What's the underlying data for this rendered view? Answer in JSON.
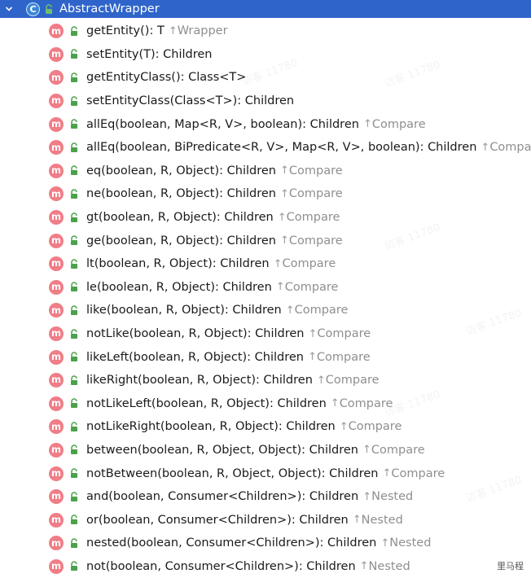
{
  "header": {
    "title": "AbstractWrapper",
    "class_icon_letter": "C",
    "expand_icon": "chevron-down-icon"
  },
  "method_icon_letter": "m",
  "arrow": "↑",
  "methods": [
    {
      "signature": "getEntity(): T",
      "parent": "Wrapper"
    },
    {
      "signature": "setEntity(T): Children",
      "parent": ""
    },
    {
      "signature": "getEntityClass(): Class<T>",
      "parent": ""
    },
    {
      "signature": "setEntityClass(Class<T>): Children",
      "parent": ""
    },
    {
      "signature": "allEq(boolean, Map<R, V>, boolean): Children",
      "parent": "Compare"
    },
    {
      "signature": "allEq(boolean, BiPredicate<R, V>, Map<R, V>, boolean): Children",
      "parent": "Compare"
    },
    {
      "signature": "eq(boolean, R, Object): Children",
      "parent": "Compare"
    },
    {
      "signature": "ne(boolean, R, Object): Children",
      "parent": "Compare"
    },
    {
      "signature": "gt(boolean, R, Object): Children",
      "parent": "Compare"
    },
    {
      "signature": "ge(boolean, R, Object): Children",
      "parent": "Compare"
    },
    {
      "signature": "lt(boolean, R, Object): Children",
      "parent": "Compare"
    },
    {
      "signature": "le(boolean, R, Object): Children",
      "parent": "Compare"
    },
    {
      "signature": "like(boolean, R, Object): Children",
      "parent": "Compare"
    },
    {
      "signature": "notLike(boolean, R, Object): Children",
      "parent": "Compare"
    },
    {
      "signature": "likeLeft(boolean, R, Object): Children",
      "parent": "Compare"
    },
    {
      "signature": "likeRight(boolean, R, Object): Children",
      "parent": "Compare"
    },
    {
      "signature": "notLikeLeft(boolean, R, Object): Children",
      "parent": "Compare"
    },
    {
      "signature": "notLikeRight(boolean, R, Object): Children",
      "parent": "Compare"
    },
    {
      "signature": "between(boolean, R, Object, Object): Children",
      "parent": "Compare"
    },
    {
      "signature": "notBetween(boolean, R, Object, Object): Children",
      "parent": "Compare"
    },
    {
      "signature": "and(boolean, Consumer<Children>): Children",
      "parent": "Nested"
    },
    {
      "signature": "or(boolean, Consumer<Children>): Children",
      "parent": "Nested"
    },
    {
      "signature": "nested(boolean, Consumer<Children>): Children",
      "parent": "Nested"
    },
    {
      "signature": "not(boolean, Consumer<Children>): Children",
      "parent": "Nested"
    }
  ],
  "watermark": "访客 11780",
  "corner_label": "里马程",
  "colors": {
    "header_bg": "#2f65ca",
    "method_icon": "#f07d87",
    "lock_green": "#4aa24a",
    "parent_text": "#8f8f8f"
  }
}
